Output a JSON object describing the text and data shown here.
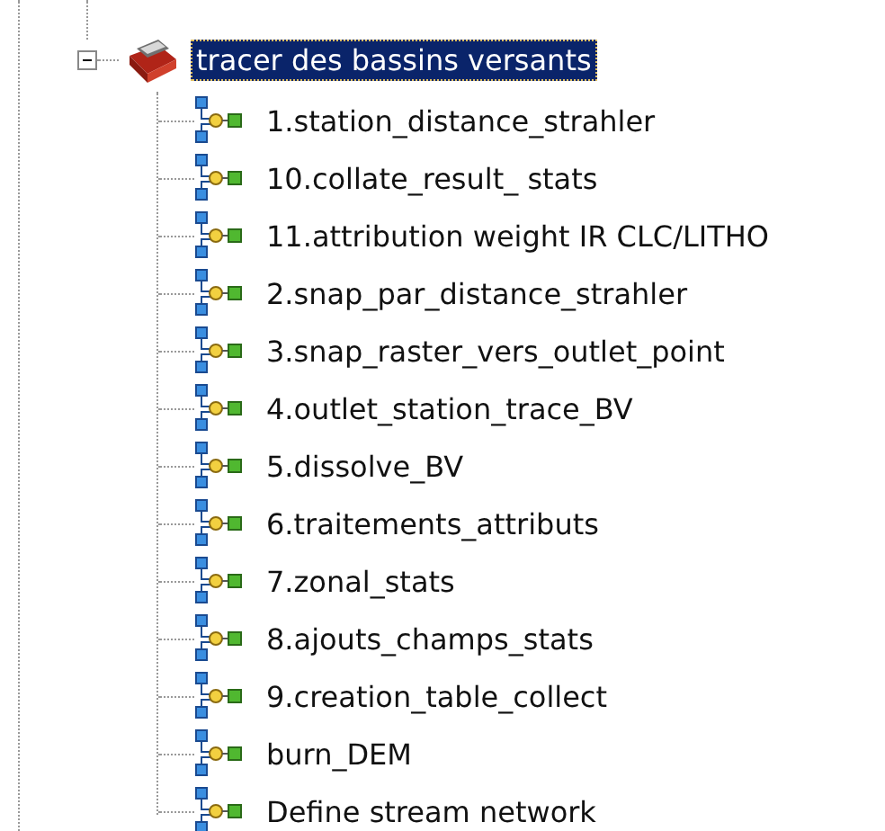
{
  "tree": {
    "label": "tracer des bassins versants",
    "expanded": true,
    "selected": true,
    "children": [
      {
        "label": "1.station_distance_strahler",
        "selected": false
      },
      {
        "label": "10.collate_result_ stats",
        "selected": false
      },
      {
        "label": "11.attribution weight IR CLC/LITHO",
        "selected": false
      },
      {
        "label": "2.snap_par_distance_strahler",
        "selected": false
      },
      {
        "label": "3.snap_raster_vers_outlet_point",
        "selected": false
      },
      {
        "label": "4.outlet_station_trace_BV",
        "selected": false
      },
      {
        "label": "5.dissolve_BV",
        "selected": false
      },
      {
        "label": "6.traitements_attributs",
        "selected": false
      },
      {
        "label": "7.zonal_stats",
        "selected": false
      },
      {
        "label": "8.ajouts_champs_stats",
        "selected": false
      },
      {
        "label": "9.creation_table_collect",
        "selected": false
      },
      {
        "label": "burn_DEM",
        "selected": false
      },
      {
        "label": "Define stream network",
        "selected": false
      }
    ]
  }
}
